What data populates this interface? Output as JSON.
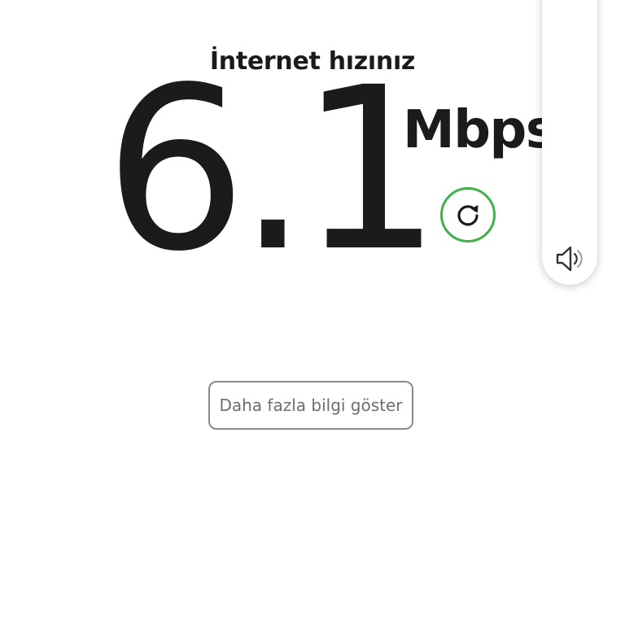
{
  "header": {
    "title": "İnternet hızınız"
  },
  "speed": {
    "value": "6.1",
    "unit": "Mbps"
  },
  "actions": {
    "refresh_icon": "refresh-icon",
    "more_info_label": "Daha fazla bilgi göster"
  },
  "side_panel": {
    "speaker_icon": "speaker-icon"
  },
  "colors": {
    "accent": "#3fb14a",
    "text": "#1b1b1b",
    "button_border": "#8a8a8a",
    "button_text": "#6e6e6e"
  }
}
